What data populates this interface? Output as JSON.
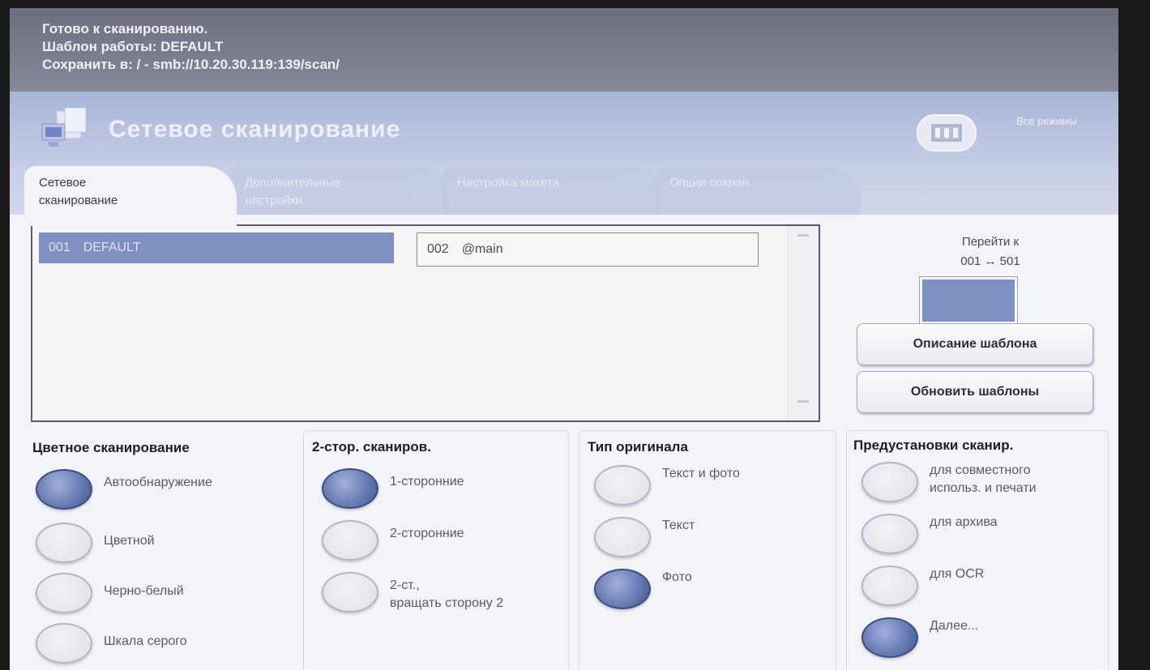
{
  "status": {
    "line1": "Готово к сканированию.",
    "line2": "Шаблон работы: DEFAULT",
    "line3": "Сохранить в: / - smb://10.20.30.119:139/scan/"
  },
  "header": {
    "title": "Сетевое сканирование",
    "all_modes_label": "Все режимы"
  },
  "tabs": [
    {
      "label": "Сетевое сканирование"
    },
    {
      "label": "Дополнительные настройки"
    },
    {
      "label": "Настройка макета"
    },
    {
      "label": "Опции сохран."
    }
  ],
  "templates": [
    {
      "number": "001",
      "name": "DEFAULT"
    },
    {
      "number": "002",
      "name": "@main"
    }
  ],
  "goto": {
    "label": "Перейти к",
    "range": "001 ↔ 501"
  },
  "buttons": {
    "template_description": "Описание шаблона",
    "update_templates": "Обновить шаблоны"
  },
  "color_scanning": {
    "title": "Цветное сканирование",
    "options": [
      {
        "label": "Автообнаружение",
        "checked": true
      },
      {
        "label": "Цветной",
        "checked": false
      },
      {
        "label": "Черно-белый",
        "checked": false
      },
      {
        "label": "Шкала серого",
        "checked": false
      }
    ]
  },
  "duplex": {
    "title": "2-стор. сканиров.",
    "options": [
      {
        "label": "1-сторонние",
        "checked": true
      },
      {
        "label": "2-сторонние",
        "checked": false
      },
      {
        "label": "2-ст.,",
        "label2": "вращать сторону 2",
        "checked": false
      }
    ]
  },
  "original_type": {
    "title": "Тип оригинала",
    "options": [
      {
        "label": "Текст и фото",
        "checked": false
      },
      {
        "label": "Текст",
        "checked": false
      },
      {
        "label": "Фото",
        "checked": true
      }
    ]
  },
  "presets": {
    "title": "Предустановки сканир.",
    "options": [
      {
        "label": "для совместного",
        "label2": "использ. и печати",
        "checked": false
      },
      {
        "label": "для архива",
        "checked": false
      },
      {
        "label": "для OCR",
        "checked": false
      },
      {
        "label": "Далее...",
        "checked": true
      }
    ]
  },
  "colors": {
    "selection": "#7e8fc2",
    "header": "#a9b4d6",
    "status": "#6c6f80"
  }
}
